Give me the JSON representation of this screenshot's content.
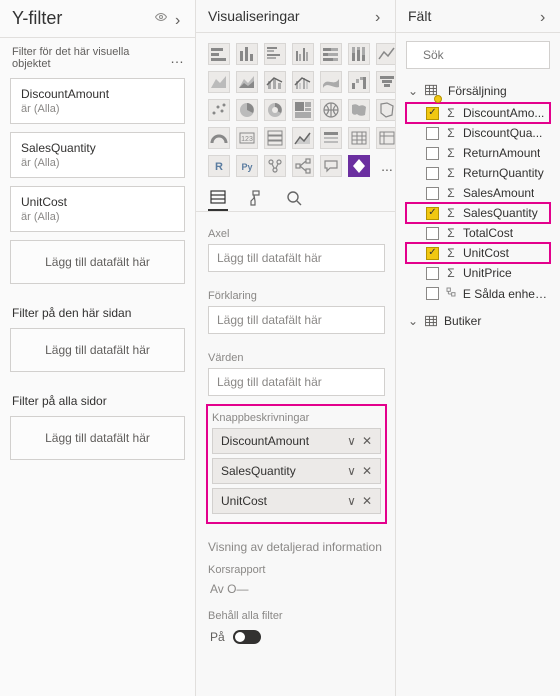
{
  "filters": {
    "title": "Y-filter",
    "visualSection": "Filter för det här visuella objektet",
    "cards": [
      {
        "name": "DiscountAmount",
        "value": "är (Alla)"
      },
      {
        "name": "SalesQuantity",
        "value": "är (Alla)"
      },
      {
        "name": "UnitCost",
        "value": "är (Alla)"
      }
    ],
    "addField": "Lägg till datafält här",
    "pageSection": "Filter på den här sidan",
    "allPagesSection": "Filter på alla sidor"
  },
  "viz": {
    "title": "Visualiseringar",
    "moreIcon": "...",
    "wells": {
      "axis": {
        "label": "Axel",
        "placeholder": "Lägg till datafält här"
      },
      "legend": {
        "label": "Förklaring",
        "placeholder": "Lägg till datafält här"
      },
      "values": {
        "label": "Värden",
        "placeholder": "Lägg till datafält här"
      },
      "tooltips": {
        "label": "Knappbeskrivningar",
        "items": [
          "DiscountAmount",
          "SalesQuantity",
          "UnitCost"
        ]
      }
    },
    "drillSection": "Visning av detaljerad information",
    "crossReport": {
      "label": "Korsrapport",
      "value": "Av  O—"
    },
    "keepFilters": {
      "label": "Behåll alla filter",
      "value": "På"
    }
  },
  "fields": {
    "title": "Fält",
    "searchPlaceholder": "Sök",
    "tables": [
      {
        "name": "Försäljning",
        "expanded": true,
        "items": [
          {
            "name": "DiscountAmo...",
            "sigma": true,
            "checked": true,
            "highlight": true
          },
          {
            "name": "DiscountQua...",
            "sigma": true,
            "checked": false
          },
          {
            "name": "ReturnAmount",
            "sigma": true,
            "checked": false
          },
          {
            "name": "ReturnQuantity",
            "sigma": true,
            "checked": false
          },
          {
            "name": "SalesAmount",
            "sigma": true,
            "checked": false
          },
          {
            "name": "SalesQuantity",
            "sigma": true,
            "checked": true,
            "highlight": true
          },
          {
            "name": "TotalCost",
            "sigma": true,
            "checked": false
          },
          {
            "name": "UnitCost",
            "sigma": true,
            "checked": true,
            "highlight": true
          },
          {
            "name": "UnitPrice",
            "sigma": true,
            "checked": false
          },
          {
            "name": "E Sålda enheter",
            "sigma": false,
            "checked": false
          }
        ]
      },
      {
        "name": "Butiker",
        "expanded": false,
        "items": []
      }
    ]
  }
}
